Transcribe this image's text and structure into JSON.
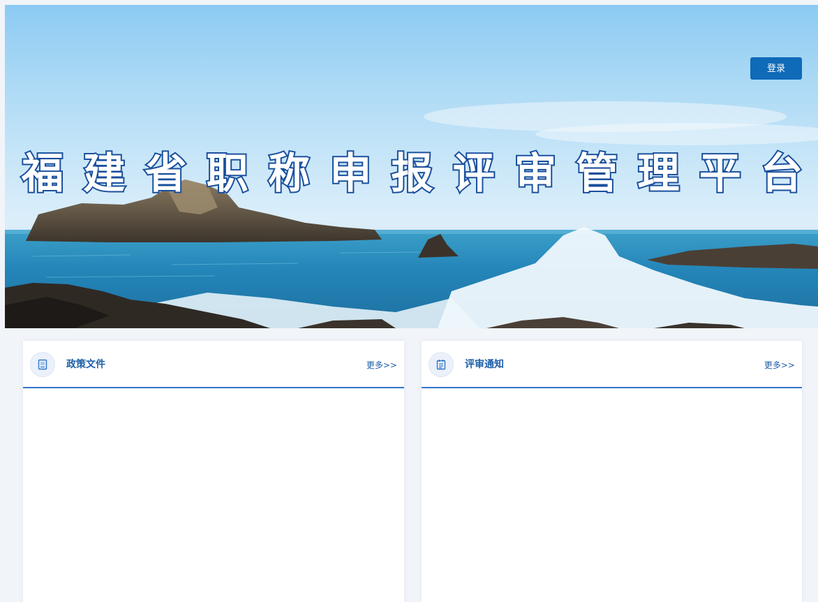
{
  "header": {
    "login_label": "登录",
    "title_chars": [
      "福",
      "建",
      "省",
      "职",
      "称",
      "申",
      "报",
      "评",
      "审",
      "管",
      "理",
      "平",
      "台"
    ]
  },
  "panels": [
    {
      "title": "政策文件",
      "more_label": "更多>>",
      "icon": "document-icon"
    },
    {
      "title": "评审通知",
      "more_label": "更多>>",
      "icon": "notice-icon"
    }
  ],
  "colors": {
    "primary": "#0f6ab8",
    "title_stroke": "#1a4f9c",
    "panel_accent": "#2f76c9",
    "page_bg": "#f1f4f9"
  }
}
